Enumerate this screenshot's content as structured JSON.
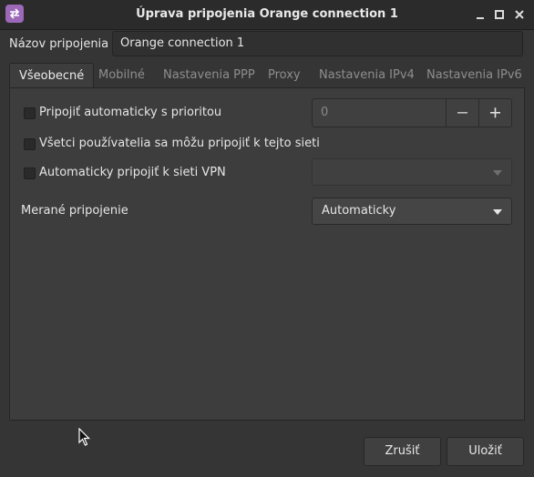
{
  "window": {
    "title": "Úprava pripojenia Orange connection 1"
  },
  "connection_name": {
    "label": "Názov pripojenia",
    "value": "Orange connection 1"
  },
  "tabs": [
    {
      "label": "Všeobecné",
      "active": true
    },
    {
      "label": "Mobilné",
      "active": false
    },
    {
      "label": "Nastavenia PPP",
      "active": false
    },
    {
      "label": "Proxy",
      "active": false
    },
    {
      "label": "Nastavenia IPv4",
      "active": false
    },
    {
      "label": "Nastavenia IPv6",
      "active": false
    }
  ],
  "general": {
    "auto_connect": {
      "label": "Pripojiť automaticky s prioritou",
      "checked": false
    },
    "priority": {
      "value": "0"
    },
    "all_users": {
      "label": "Všetci používatelia sa môžu pripojiť k tejto sieti",
      "checked": false
    },
    "auto_vpn": {
      "label": "Automaticky pripojiť k sieti VPN",
      "checked": false,
      "selected": ""
    },
    "metered": {
      "label": "Merané pripojenie",
      "selected": "Automaticky"
    }
  },
  "buttons": {
    "cancel": "Zrušiť",
    "save": "Uložiť"
  },
  "colors": {
    "window_bg": "#353535",
    "panel_bg": "#3d3d3d",
    "titlebar_bg": "#2b2b2b",
    "app_icon": "#9c68b8"
  }
}
